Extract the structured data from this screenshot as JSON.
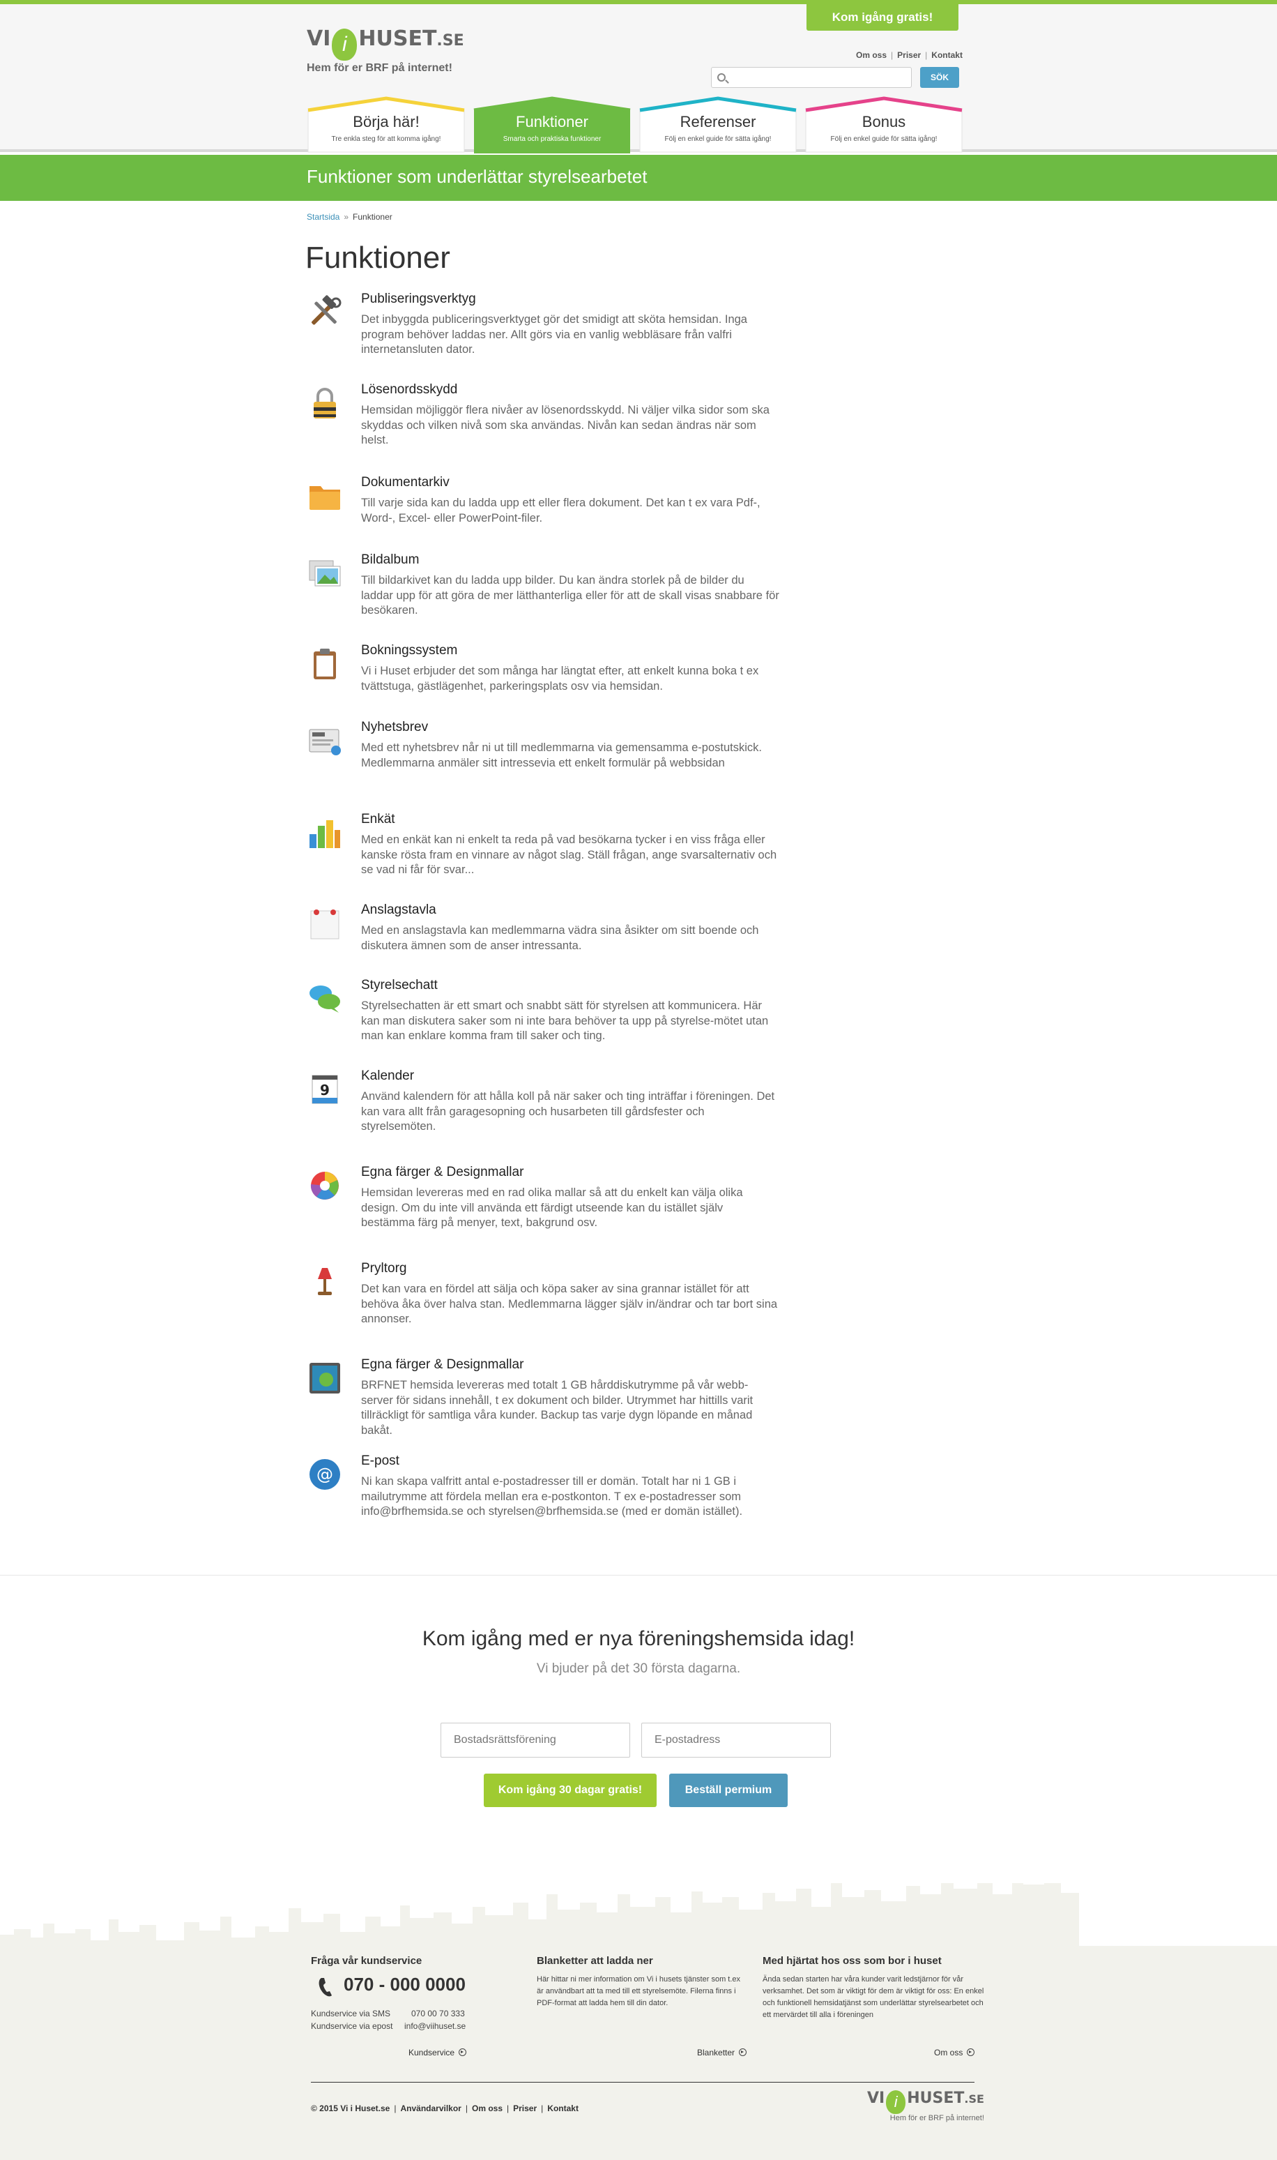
{
  "header": {
    "cta": "Kom igång gratis!",
    "logo": {
      "prefix": "VI",
      "letter": "i",
      "word": "HUSET",
      "tld": ".SE",
      "tagline": "Hem för er BRF på internet!"
    },
    "toplinks": [
      "Om oss",
      "Priser",
      "Kontakt"
    ],
    "search": {
      "placeholder": "",
      "button": "SÖK"
    },
    "colors": {
      "brand_green": "#8dc63f",
      "banner_green": "#6dbb43",
      "accent_blue": "#4da0c8"
    }
  },
  "tabs": [
    {
      "title": "Börja här!",
      "sub": "Tre enkla steg för att komma igång!",
      "color": "#f5d23a",
      "active": false
    },
    {
      "title": "Funktioner",
      "sub": "Smarta och praktiska funktioner",
      "color": "#6dbb43",
      "active": true
    },
    {
      "title": "Referenser",
      "sub": "Följ en enkel guide för sätta igång!",
      "color": "#1fb3c7",
      "active": false
    },
    {
      "title": "Bonus",
      "sub": "Följ en enkel guide för sätta igång!",
      "color": "#e5428a",
      "active": false
    }
  ],
  "banner": {
    "text": "Funktioner som underlättar styrelsearbetet"
  },
  "breadcrumb": {
    "home": "Startsida",
    "current": "Funktioner"
  },
  "page_title": "Funktioner",
  "features": [
    {
      "icon": "tools-icon",
      "title": "Publiseringsverktyg",
      "desc": "Det inbyggda publiceringsverktyget gör det smidigt att sköta hemsidan. Inga program behöver laddas ner. Allt görs via en vanlig webbläsare från valfri internetansluten dator."
    },
    {
      "icon": "padlock-icon",
      "title": "Lösenordsskydd",
      "desc": "Hemsidan möjliggör flera nivåer av lösenordsskydd. Ni väljer vilka sidor som ska skyddas och vilken nivå som ska användas. Nivån kan sedan ändras när som helst."
    },
    {
      "icon": "folder-icon",
      "title": "Dokumentarkiv",
      "desc": "Till varje sida kan du ladda upp ett eller flera dokument. Det kan t ex vara Pdf-, Word-, Excel- eller PowerPoint-filer."
    },
    {
      "icon": "photo-album-icon",
      "title": "Bildalbum",
      "desc": "Till bildarkivet kan du ladda upp bilder. Du kan ändra storlek på de bilder du laddar upp för att göra de mer lätthanterliga eller för att de skall visas snabbare för besökaren."
    },
    {
      "icon": "clipboard-icon",
      "title": "Bokningssystem",
      "desc": "Vi i Huset erbjuder det som många har längtat efter, att enkelt kunna boka t ex tvättstuga, gästlägenhet, parkeringsplats osv via hemsidan."
    },
    {
      "icon": "newsletter-icon",
      "title": "Nyhetsbrev",
      "desc": "Med ett nyhetsbrev når ni ut till medlemmarna via gemensamma e-postutskick. Medlemmarna anmäler sitt intressevia ett enkelt formulär på webbsidan"
    },
    {
      "icon": "bar-chart-icon",
      "title": "Enkät",
      "desc": "Med en enkät kan ni enkelt ta reda på vad besökarna tycker i en viss fråga eller kanske rösta fram en vinnare av något slag. Ställ frågan, ange svarsalternativ och se vad ni får för svar..."
    },
    {
      "icon": "notice-board-icon",
      "title": "Anslagstavla",
      "desc": "Med en anslagstavla kan medlemmarna vädra sina åsikter om sitt boende och diskutera ämnen som de anser intressanta."
    },
    {
      "icon": "chat-bubbles-icon",
      "title": "Styrelsechatt",
      "desc": "Styrelsechatten är ett smart och snabbt sätt för styrelsen att kommunicera. Här kan man diskutera saker som ni inte bara behöver ta upp på styrelse-mötet utan man kan enklare komma fram till saker och ting."
    },
    {
      "icon": "calendar-icon",
      "title": "Kalender",
      "desc": "Använd kalendern för att hålla koll på när saker och ting inträffar i föreningen. Det kan vara allt från garagesopning och husarbeten till gårdsfester och styrelsemöten.",
      "badge": "9"
    },
    {
      "icon": "color-wheel-icon",
      "title": "Egna färger & Designmallar",
      "desc": "Hemsidan levereras med en rad olika mallar så att du enkelt kan välja olika design. Om du inte vill använda ett färdigt utseende kan du istället själv bestämma färg på menyer, text, bakgrund osv."
    },
    {
      "icon": "lamp-icon",
      "title": "Pryltorg",
      "desc": "Det kan vara en fördel att sälja och köpa saker av sina grannar istället för att behöva åka över halva stan. Medlemmarna lägger själv in/ändrar och tar bort sina annonser."
    },
    {
      "icon": "hard-drive-icon",
      "title": "Egna färger & Designmallar",
      "desc": "BRFNET hemsida levereras med totalt 1 GB hårddiskutrymme på vår webb-server för sidans innehåll, t ex dokument och bilder. Utrymmet har hittills varit tillräckligt för samtliga våra kunder. Backup tas varje dygn löpande en månad bakåt."
    },
    {
      "icon": "at-sign-icon",
      "title": "E-post",
      "desc": "Ni kan skapa valfritt antal e-postadresser till er domän. Totalt har ni 1 GB i mailutrymme att fördela mellan era e-postkonton. T ex e-postadresser som info@brfhemsida.se och styrelsen@brfhemsida.se (med er domän istället)."
    }
  ],
  "signup": {
    "title": "Kom igång med er nya föreningshemsida idag!",
    "subtitle": "Vi bjuder på det 30 första dagarna.",
    "name_placeholder": "Bostadsrättsförening",
    "email_placeholder": "E-postadress",
    "primary_button": "Kom igång 30 dagar gratis!",
    "secondary_button": "Beställ permium"
  },
  "footer": {
    "col1": {
      "title": "Fråga vår kundservice",
      "phone": "070 - 000 0000",
      "sms_label": "Kundservice via SMS",
      "sms_value": "070 00 70 333",
      "email_label": "Kundservice via epost",
      "email_value": "info@viihuset.se",
      "link": "Kundservice"
    },
    "col2": {
      "title": "Blanketter att ladda ner",
      "text": "Här hittar ni mer information om Vi i husets tjänster som t.ex är användbart att ta med till ett styrelsemöte. Filerna finns i PDF-format att ladda hem till din dator.",
      "link": "Blanketter"
    },
    "col3": {
      "title": "Med hjärtat hos oss som bor i huset",
      "text": "Ända sedan starten har våra kunder varit ledstjärnor för vår verksamhet. Det som är viktigt för dem är viktigt för oss: En enkel och funktionell hemsidatjänst som underlättar styrelsearbetet och ett mervärdet till alla i föreningen",
      "link": "Om oss"
    },
    "copyright": "© 2015 Vi i Huset.se",
    "bottom_links": [
      "Användarvilkor",
      "Om oss",
      "Priser",
      "Kontakt"
    ],
    "logo_tagline": "Hem för er BRF på internet!"
  }
}
